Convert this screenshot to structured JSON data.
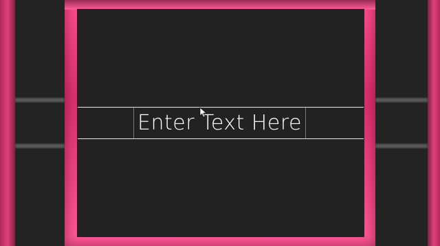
{
  "editor": {
    "text_layer": {
      "value": "Enter Text Here"
    }
  },
  "colors": {
    "frame_pink": "#ff4f8f",
    "canvas_dark": "#222222",
    "text_white": "#ffffff"
  },
  "icons": {
    "cursor": "mouse-pointer-icon"
  }
}
